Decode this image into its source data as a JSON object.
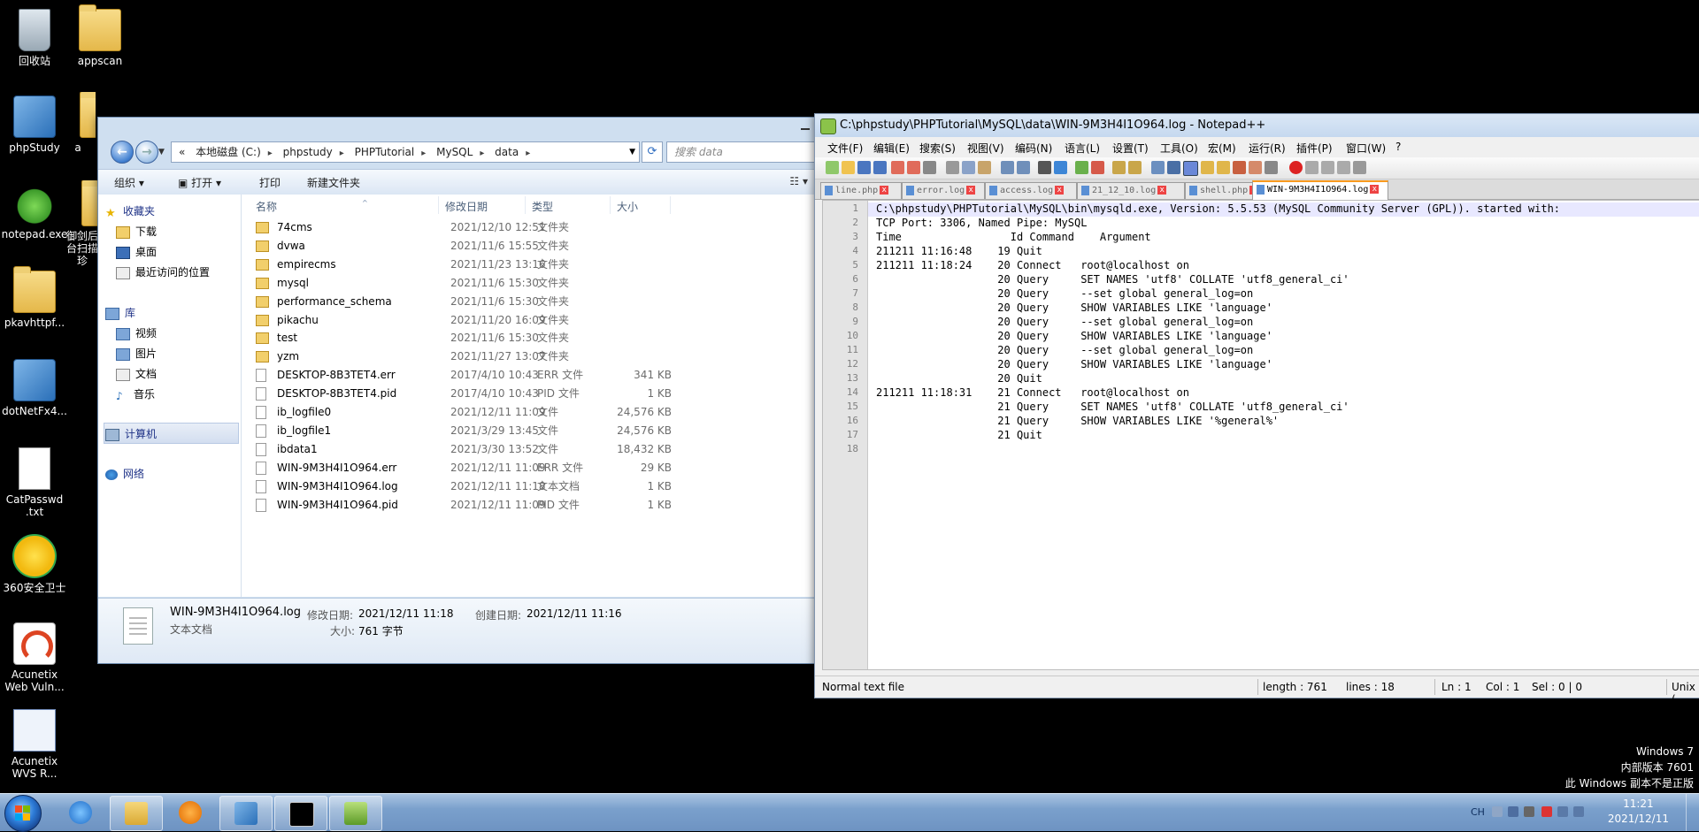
{
  "desktop": {
    "icons": [
      "回收站",
      "appscan",
      "phpStudy",
      "a",
      "notepad.exe",
      "御剑后台扫描珍",
      "pkavhttpf...",
      "dotNetFx4...",
      "CatPasswd\n.txt",
      "360安全卫士",
      "Acunetix\nWeb Vuln...",
      "Acunetix\nWVS R..."
    ],
    "watermark": [
      "Windows 7",
      "内部版本 7601",
      "此 Windows 副本不是正版"
    ]
  },
  "explorer": {
    "breadcrumb": [
      "«",
      "本地磁盘 (C:)",
      "phpstudy",
      "PHPTutorial",
      "MySQL",
      "data"
    ],
    "search_placeholder": "搜索 data",
    "toolbar": {
      "organize": "组织 ▾",
      "open": "打开 ▾",
      "print": "打印",
      "new_folder": "新建文件夹"
    },
    "nav": {
      "favorites": "收藏夹",
      "fav_items": [
        "下载",
        "桌面",
        "最近访问的位置"
      ],
      "libraries": "库",
      "lib_items": [
        "视频",
        "图片",
        "文档",
        "音乐"
      ],
      "computer": "计算机",
      "network": "网络"
    },
    "columns": {
      "name": "名称",
      "date": "修改日期",
      "type": "类型",
      "size": "大小"
    },
    "files": [
      {
        "name": "74cms",
        "date": "2021/12/10 12:51",
        "type": "文件夹",
        "size": ""
      },
      {
        "name": "dvwa",
        "date": "2021/11/6 15:55",
        "type": "文件夹",
        "size": ""
      },
      {
        "name": "empirecms",
        "date": "2021/11/23 13:16",
        "type": "文件夹",
        "size": ""
      },
      {
        "name": "mysql",
        "date": "2021/11/6 15:30",
        "type": "文件夹",
        "size": ""
      },
      {
        "name": "performance_schema",
        "date": "2021/11/6 15:30",
        "type": "文件夹",
        "size": ""
      },
      {
        "name": "pikachu",
        "date": "2021/11/20 16:09",
        "type": "文件夹",
        "size": ""
      },
      {
        "name": "test",
        "date": "2021/11/6 15:30",
        "type": "文件夹",
        "size": ""
      },
      {
        "name": "yzm",
        "date": "2021/11/27 13:07",
        "type": "文件夹",
        "size": ""
      },
      {
        "name": "DESKTOP-8B3TET4.err",
        "date": "2017/4/10 10:43",
        "type": "ERR 文件",
        "size": "341 KB"
      },
      {
        "name": "DESKTOP-8B3TET4.pid",
        "date": "2017/4/10 10:43",
        "type": "PID 文件",
        "size": "1 KB"
      },
      {
        "name": "ib_logfile0",
        "date": "2021/12/11 11:09",
        "type": "文件",
        "size": "24,576 KB"
      },
      {
        "name": "ib_logfile1",
        "date": "2021/3/29 13:45",
        "type": "文件",
        "size": "24,576 KB"
      },
      {
        "name": "ibdata1",
        "date": "2021/3/30 13:52",
        "type": "文件",
        "size": "18,432 KB"
      },
      {
        "name": "WIN-9M3H4I1O964.err",
        "date": "2021/12/11 11:09",
        "type": "ERR 文件",
        "size": "29 KB"
      },
      {
        "name": "WIN-9M3H4I1O964.log",
        "date": "2021/12/11 11:18",
        "type": "文本文档",
        "size": "1 KB"
      },
      {
        "name": "WIN-9M3H4I1O964.pid",
        "date": "2021/12/11 11:09",
        "type": "PID 文件",
        "size": "1 KB"
      }
    ],
    "details": {
      "filename": "WIN-9M3H4I1O964.log",
      "modified_label": "修改日期:",
      "modified": "2021/12/11 11:18",
      "created_label": "创建日期:",
      "created": "2021/12/11 11:16",
      "type": "文本文档",
      "size_label": "大小:",
      "size": "761 字节"
    }
  },
  "notepad": {
    "title": "C:\\phpstudy\\PHPTutorial\\MySQL\\data\\WIN-9M3H4I1O964.log - Notepad++",
    "menu": [
      "文件(F)",
      "编辑(E)",
      "搜索(S)",
      "视图(V)",
      "编码(N)",
      "语言(L)",
      "设置(T)",
      "工具(O)",
      "宏(M)",
      "运行(R)",
      "插件(P)",
      "窗口(W)",
      "?"
    ],
    "tabs": [
      "line.php",
      "error.log",
      "access.log",
      "21_12_10.log",
      "shell.php",
      "WIN-9M3H4I1O964.log"
    ],
    "lines": [
      "C:\\phpstudy\\PHPTutorial\\MySQL\\bin\\mysqld.exe, Version: 5.5.53 (MySQL Community Server (GPL)). started with:",
      "TCP Port: 3306, Named Pipe: MySQL",
      "Time                 Id Command    Argument",
      "211211 11:16:48\t   19 Quit",
      "211211 11:18:24\t   20 Connect\troot@localhost on",
      "\t\t   20 Query\tSET NAMES 'utf8' COLLATE 'utf8_general_ci'",
      "\t\t   20 Query\t--set global general_log=on",
      "\t\t   20 Query\tSHOW VARIABLES LIKE 'language'",
      "\t\t   20 Query\t--set global general_log=on",
      "\t\t   20 Query\tSHOW VARIABLES LIKE 'language'",
      "\t\t   20 Query\t--set global general_log=on",
      "\t\t   20 Query\tSHOW VARIABLES LIKE 'language'",
      "\t\t   20 Quit",
      "211211 11:18:31\t   21 Connect\troot@localhost on",
      "\t\t   21 Query\tSET NAMES 'utf8' COLLATE 'utf8_general_ci'",
      "\t\t   21 Query\tSHOW VARIABLES LIKE '%general%'",
      "\t\t   21 Quit",
      ""
    ],
    "status": {
      "type": "Normal text file",
      "length": "length : 761",
      "lines": "lines : 18",
      "ln": "Ln : 1",
      "col": "Col : 1",
      "sel": "Sel : 0 | 0",
      "eol": "Unix ("
    }
  },
  "taskbar": {
    "lang": "CH",
    "time": "11:21",
    "date": "2021/12/11"
  }
}
